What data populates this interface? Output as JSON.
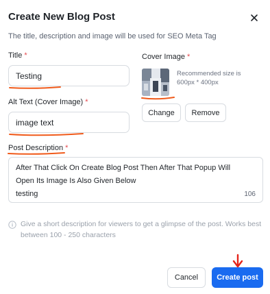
{
  "dialog": {
    "title": "Create New Blog Post",
    "subtitle": "The title, description and image will be used for SEO Meta Tag"
  },
  "form": {
    "title_label": "Title",
    "title_value": "Testing",
    "alt_label": "Alt Text (Cover Image)",
    "alt_value": "image text",
    "cover_label": "Cover Image",
    "cover_hint_line1": "Recommended size is",
    "cover_hint_line2": "600px * 400px",
    "change_label": "Change",
    "remove_label": "Remove",
    "description_label": "Post Description",
    "description_line1": "After That Click On Create Blog Post Then After That Popup Will",
    "description_line2": "Open Its Image Is Also Given Below",
    "description_line3": "testing",
    "char_count": "106",
    "required_mark": "*"
  },
  "info": {
    "text": "Give a short description for viewers to get a glimpse of the post. Works best between 100 - 250 characters"
  },
  "footer": {
    "cancel_label": "Cancel",
    "create_label": "Create post"
  },
  "colors": {
    "primary": "#1a6bf0",
    "required": "#e5484d",
    "annotation": "#f05a1a"
  }
}
